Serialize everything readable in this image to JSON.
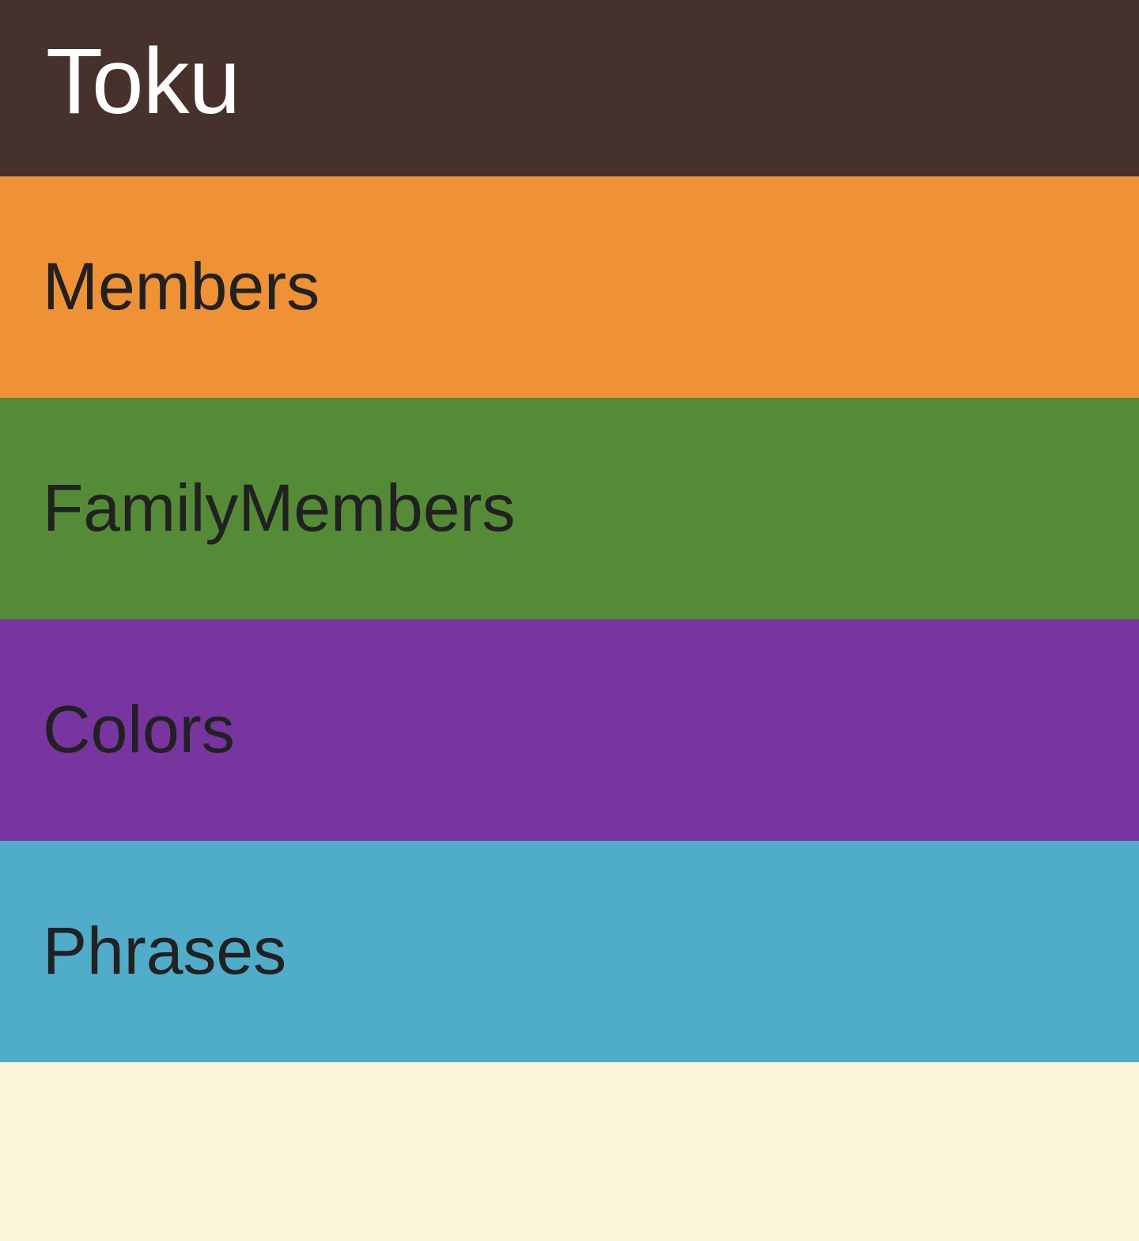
{
  "app_bar": {
    "title": "Toku",
    "background": "#46312C",
    "title_color": "#FFFFFF"
  },
  "categories": [
    {
      "label": "Members",
      "color": "#EF9235"
    },
    {
      "label": "FamilyMembers",
      "color": "#558B37"
    },
    {
      "label": "Colors",
      "color": "#79359F"
    },
    {
      "label": "Phrases",
      "color": "#50ADC9"
    }
  ],
  "page_background": "#FEF6DB",
  "text_color": "#212121"
}
